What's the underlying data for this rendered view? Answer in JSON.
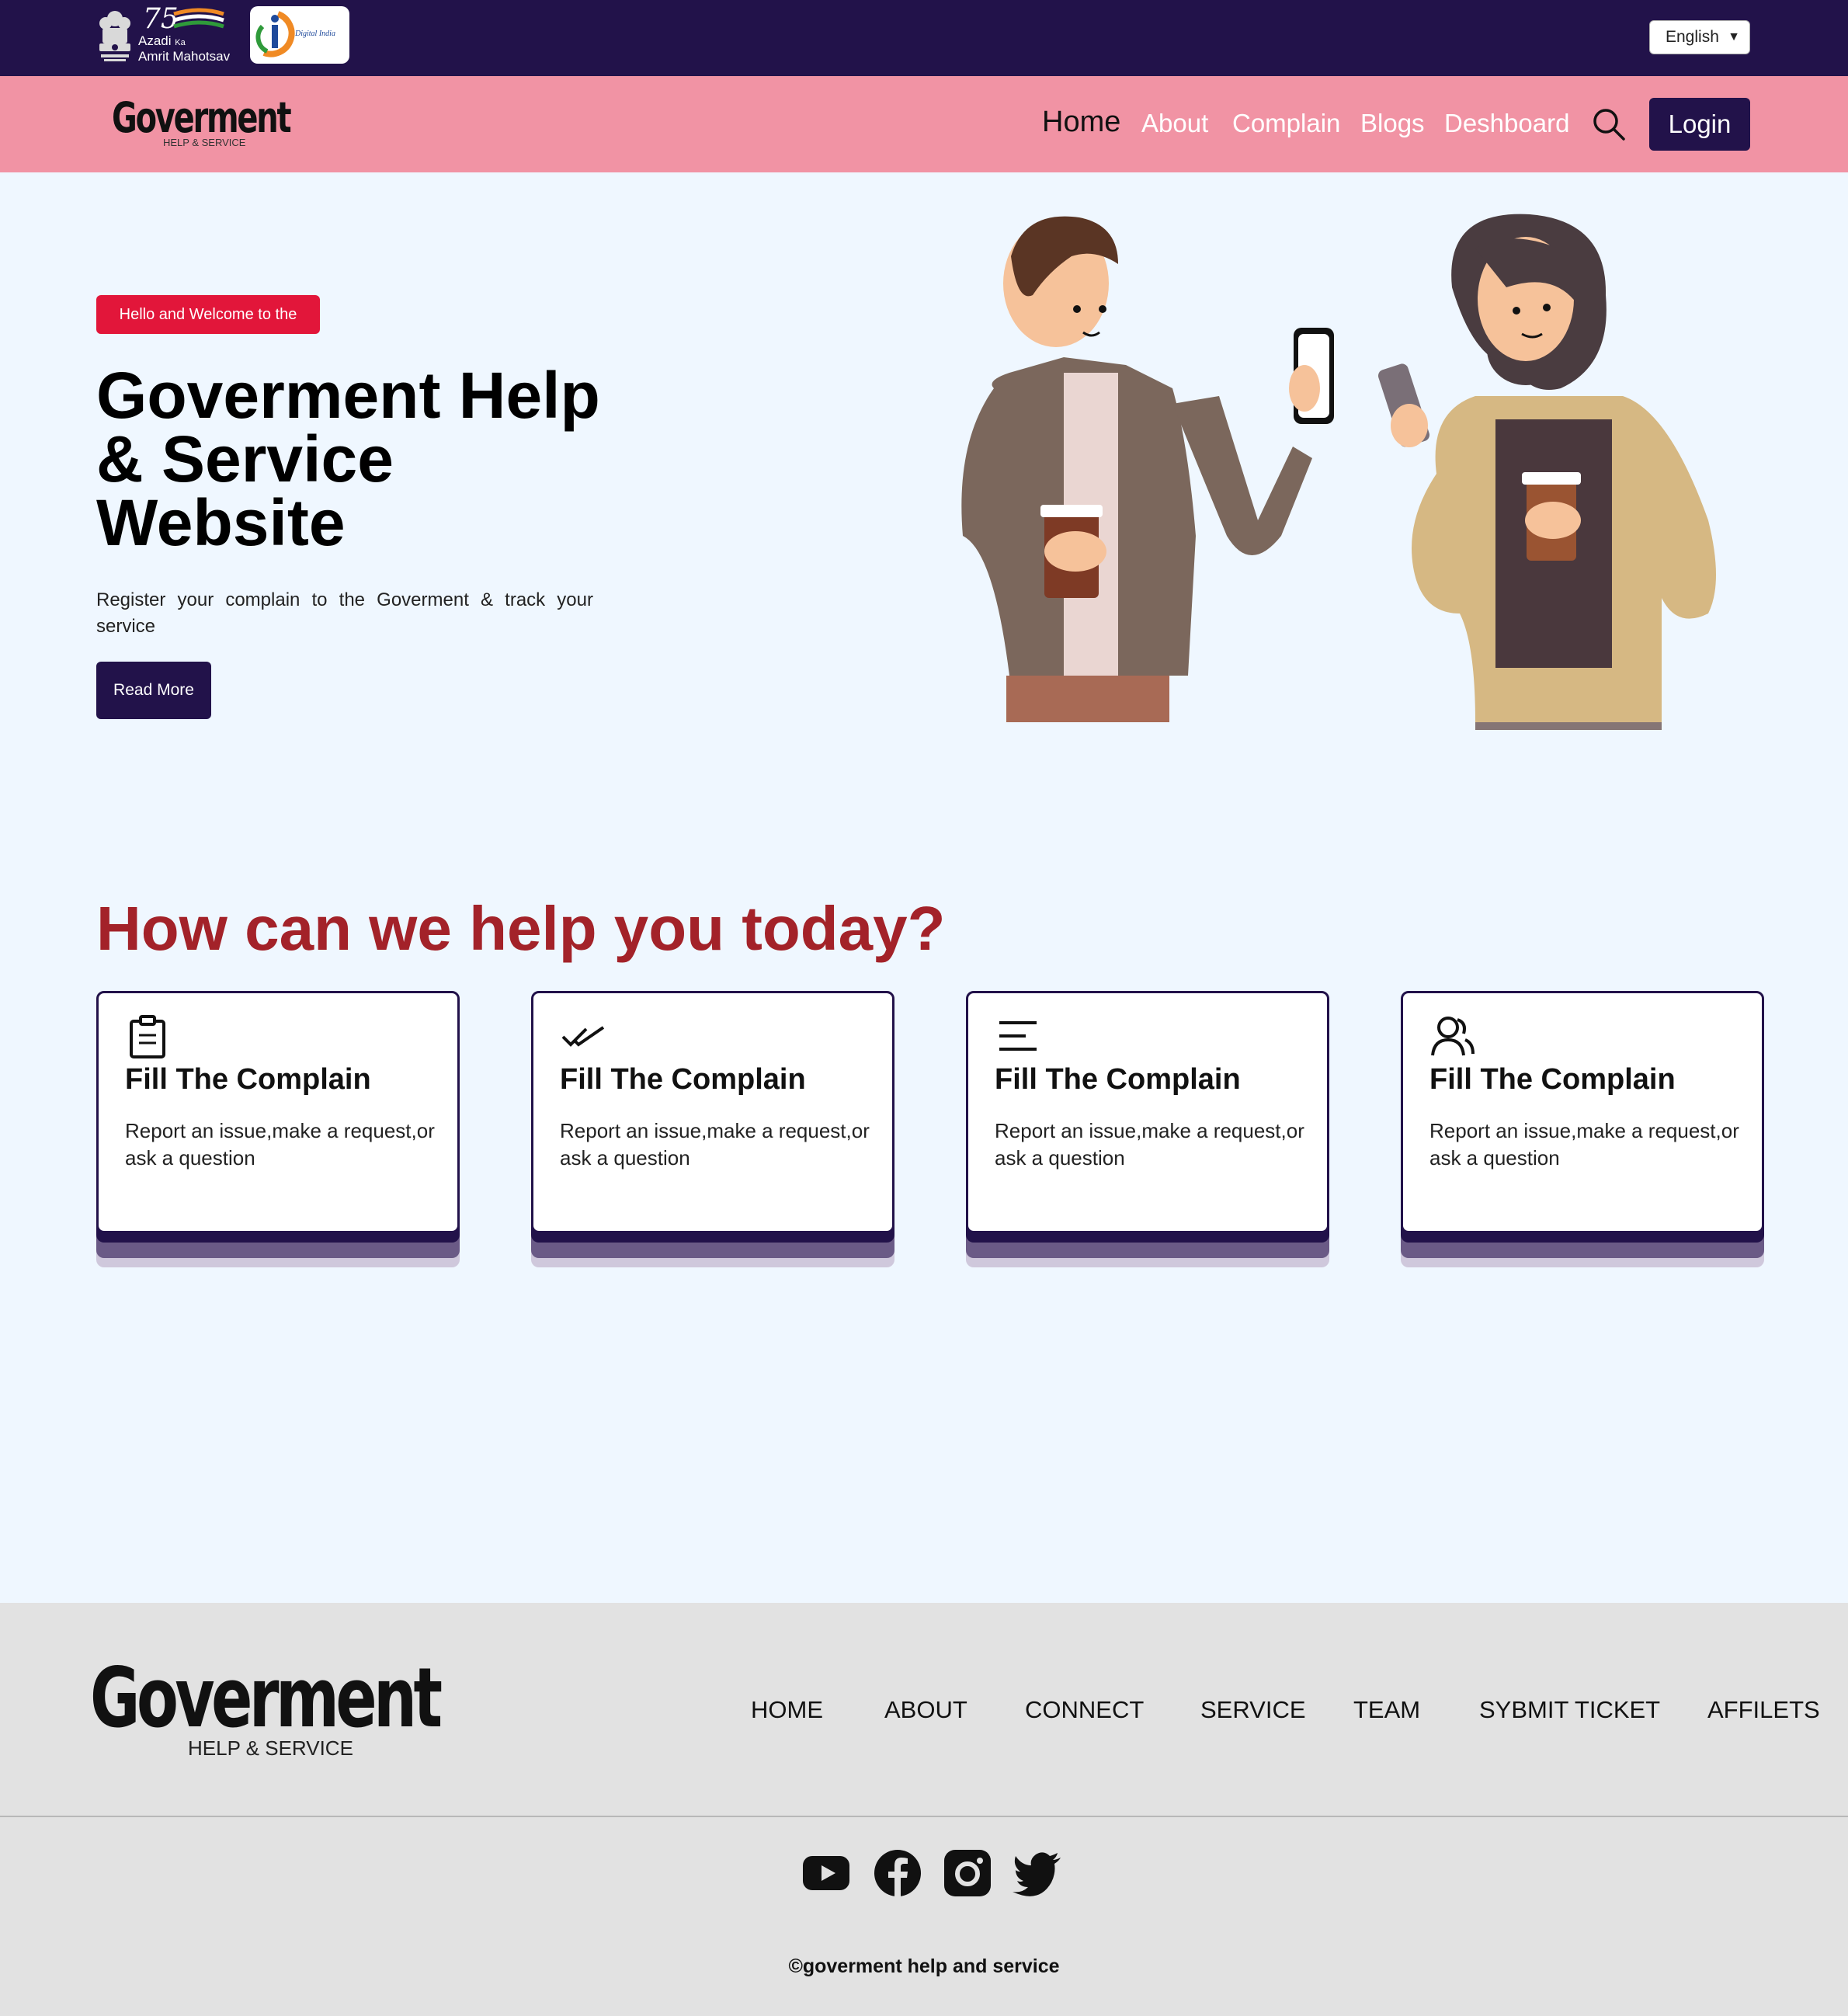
{
  "topbar": {
    "azadi_line1": "Azadi",
    "azadi_ka": "Ka",
    "azadi_line2": "Amrit Mahotsav",
    "digital_india": "Digital India",
    "language": "English"
  },
  "nav": {
    "logo": "Goverment",
    "logo_sub": "HELP & SERVICE",
    "links": [
      "Home",
      "About",
      "Complain",
      "Blogs",
      "Deshboard"
    ],
    "login": "Login"
  },
  "hero": {
    "badge": "Hello and Welcome to the",
    "title": "Goverment Help & Service Website",
    "description": "Register your complain to the Goverment & track your service",
    "button": "Read More"
  },
  "help": {
    "title": "How can we help you today?",
    "cards": [
      {
        "icon": "clipboard-icon",
        "title": "Fill The Complain",
        "desc": "Report an issue,make a request,or ask a question"
      },
      {
        "icon": "double-check-icon",
        "title": "Fill The Complain",
        "desc": "Report an issue,make a request,or ask a question"
      },
      {
        "icon": "menu-lines-icon",
        "title": "Fill The Complain",
        "desc": "Report an issue,make a request,or ask a question"
      },
      {
        "icon": "users-icon",
        "title": "Fill The Complain",
        "desc": "Report an issue,make a request,or ask a question"
      }
    ]
  },
  "footer": {
    "logo": "Goverment",
    "logo_sub": "HELP & SERVICE",
    "links": [
      "HOME",
      "ABOUT",
      "CONNECT",
      "SERVICE",
      "TEAM",
      "SYBMIT TICKET",
      "AFFILETS"
    ],
    "social_icons": [
      "youtube-icon",
      "facebook-icon",
      "instagram-icon",
      "twitter-icon"
    ],
    "copyright": "©goverment help and service"
  },
  "colors": {
    "topbar": "#22124a",
    "navbar": "#f193a4",
    "accent_red": "#a32229",
    "badge_red": "#e2163a",
    "page_bg": "#eff7ff",
    "footer_bg": "#e2e2e2"
  }
}
